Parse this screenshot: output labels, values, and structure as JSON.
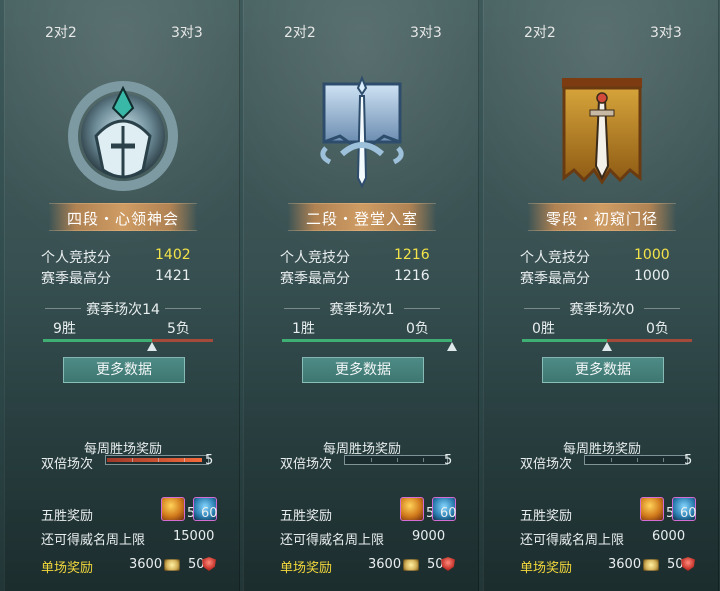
{
  "colors": {
    "accent_yellow": "#f2e34a",
    "win_green": "#3fae73",
    "loss_red": "#a34a3b",
    "rank_gold": "#d7a064",
    "button_teal": "#4e8b86"
  },
  "panels": [
    {
      "mode_tabs": [
        "2对2",
        "3对3"
      ],
      "emblem_icon": "tier4-helmet-emblem-icon",
      "rank_name": "四段・心领神会",
      "personal_score_label": "个人竞技分",
      "personal_score": "1402",
      "season_best_label": "赛季最高分",
      "season_best": "1421",
      "season_matches": "赛季场次14",
      "wins": "9胜",
      "losses": "5负",
      "win_ratio": 0.643,
      "more_button": "更多数据",
      "weekly_title": "每周胜场奖励",
      "double_label": "双倍场次",
      "double_progress_label": "5",
      "double_progress": 0.95,
      "five_win_label": "五胜奖励",
      "five_win_items": [
        {
          "icon": "treasure-chest-icon",
          "qty": "5"
        },
        {
          "icon": "scroll-icon",
          "qty": "60"
        }
      ],
      "cap_label": "还可得威名周上限",
      "cap_value": "15000",
      "single_label": "单场奖励",
      "single_coin": "3600",
      "single_shield": "50"
    },
    {
      "mode_tabs": [
        "2对2",
        "3对3"
      ],
      "emblem_icon": "tier2-banner-sword-icon",
      "rank_name": "二段・登堂入室",
      "personal_score_label": "个人竞技分",
      "personal_score": "1216",
      "season_best_label": "赛季最高分",
      "season_best": "1216",
      "season_matches": "赛季场次1",
      "wins": "1胜",
      "losses": "0负",
      "win_ratio": 1.0,
      "more_button": "更多数据",
      "weekly_title": "每周胜场奖励",
      "double_label": "双倍场次",
      "double_progress_label": "5",
      "double_progress": 0.0,
      "five_win_label": "五胜奖励",
      "five_win_items": [
        {
          "icon": "treasure-chest-icon",
          "qty": "5"
        },
        {
          "icon": "scroll-icon",
          "qty": "60"
        }
      ],
      "cap_label": "还可得威名周上限",
      "cap_value": "9000",
      "single_label": "单场奖励",
      "single_coin": "3600",
      "single_shield": "50"
    },
    {
      "mode_tabs": [
        "2对2",
        "3对3"
      ],
      "emblem_icon": "tier0-banner-dagger-icon",
      "rank_name": "零段・初窥门径",
      "personal_score_label": "个人竞技分",
      "personal_score": "1000",
      "season_best_label": "赛季最高分",
      "season_best": "1000",
      "season_matches": "赛季场次0",
      "wins": "0胜",
      "losses": "0负",
      "win_ratio": 0.5,
      "more_button": "更多数据",
      "weekly_title": "每周胜场奖励",
      "double_label": "双倍场次",
      "double_progress_label": "5",
      "double_progress": 0.0,
      "five_win_label": "五胜奖励",
      "five_win_items": [
        {
          "icon": "treasure-chest-icon",
          "qty": "5"
        },
        {
          "icon": "scroll-icon",
          "qty": "60"
        }
      ],
      "cap_label": "还可得威名周上限",
      "cap_value": "6000",
      "single_label": "单场奖励",
      "single_coin": "3600",
      "single_shield": "50"
    }
  ]
}
